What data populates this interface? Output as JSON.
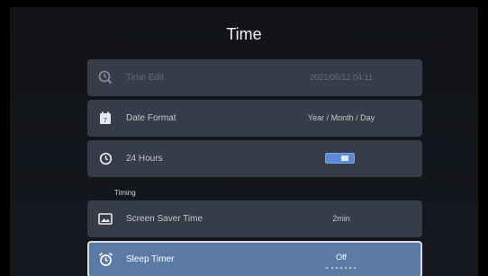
{
  "title": "Time",
  "items": {
    "time_edit": {
      "label": "Time Edit",
      "value": "2021/05/12 04:11",
      "icon": "clock-edit-icon",
      "enabled": false
    },
    "date_format": {
      "label": "Date Format",
      "value": "Year / Month / Day",
      "icon": "calendar-icon"
    },
    "hours24": {
      "label": "24 Hours",
      "icon": "clock-icon",
      "toggle_on": true
    },
    "section_timing": "Timing",
    "screen_saver": {
      "label": "Screen Saver Time",
      "value": "2min",
      "icon": "picture-icon"
    },
    "sleep_timer": {
      "label": "Sleep Timer",
      "value": "Off",
      "icon": "alarm-clock-icon",
      "selected": true
    }
  },
  "colors": {
    "panel": "#373c49",
    "selected": "#5b7ba5",
    "toggle": "#5a8bd3"
  }
}
